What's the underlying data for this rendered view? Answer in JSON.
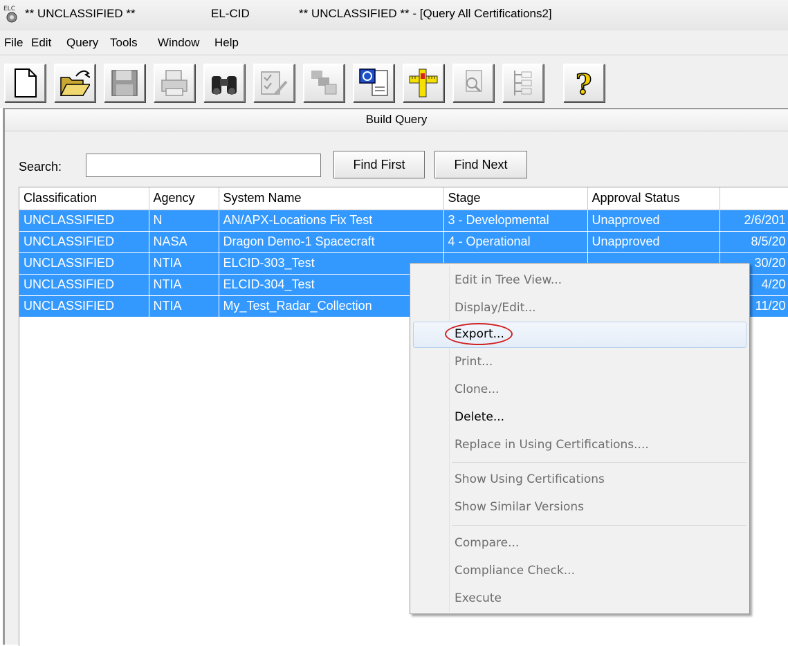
{
  "titlebar": {
    "classification_left": "** UNCLASSIFIED **",
    "app_name": "EL-CID",
    "title": "** UNCLASSIFIED ** - [Query All Certifications2]",
    "app_icon": "el-cid-app-icon"
  },
  "menu": {
    "items": [
      "File",
      "Edit",
      "Query",
      "Tools",
      "Window",
      "Help"
    ]
  },
  "toolbar": {
    "icons": [
      "new-document-icon",
      "open-folder-icon",
      "save-icon",
      "print-icon",
      "find-binoculars-icon",
      "edit-check-icon",
      "tree-icon",
      "compare-icon",
      "ruler-icon",
      "inspect-icon",
      "outline-icon",
      "help-icon"
    ]
  },
  "build_query": {
    "title": "Build Query",
    "search_label": "Search:",
    "search_value": "",
    "find_first": "Find First",
    "find_next": "Find Next"
  },
  "table": {
    "columns": [
      "Classification",
      "Agency",
      "System Name",
      "Stage",
      "Approval Status",
      ""
    ],
    "rows": [
      [
        "UNCLASSIFIED",
        "N",
        "AN/APX-Locations Fix Test",
        "3 - Developmental",
        "Unapproved",
        "2/6/201"
      ],
      [
        "UNCLASSIFIED",
        "NASA",
        "Dragon Demo-1 Spacecraft",
        "4 - Operational",
        "Unapproved",
        "8/5/20"
      ],
      [
        "UNCLASSIFIED",
        "NTIA",
        "ELCID-303_Test",
        "",
        "",
        "30/20"
      ],
      [
        "UNCLASSIFIED",
        "NTIA",
        "ELCID-304_Test",
        "",
        "",
        "4/20"
      ],
      [
        "UNCLASSIFIED",
        "NTIA",
        "My_Test_Radar_Collection",
        "",
        "",
        "11/20"
      ]
    ],
    "selection_color": "#3399ff"
  },
  "context_menu": {
    "items": [
      {
        "label": "Edit in Tree View...",
        "enabled": false
      },
      {
        "label": "Display/Edit...",
        "enabled": false
      },
      {
        "label": "Export...",
        "enabled": true,
        "highlighted": true
      },
      {
        "label": "Print...",
        "enabled": false
      },
      {
        "label": "Clone...",
        "enabled": false
      },
      {
        "label": "Delete...",
        "enabled": true
      },
      {
        "label": "Replace in Using Certifications....",
        "enabled": false
      },
      {
        "label": "Show Using Certifications",
        "enabled": false
      },
      {
        "label": "Show Similar Versions",
        "enabled": false
      },
      {
        "label": "Compare...",
        "enabled": false
      },
      {
        "label": "Compliance Check...",
        "enabled": false
      },
      {
        "label": "Execute",
        "enabled": false
      }
    ],
    "annotation_color": "#d02020"
  }
}
